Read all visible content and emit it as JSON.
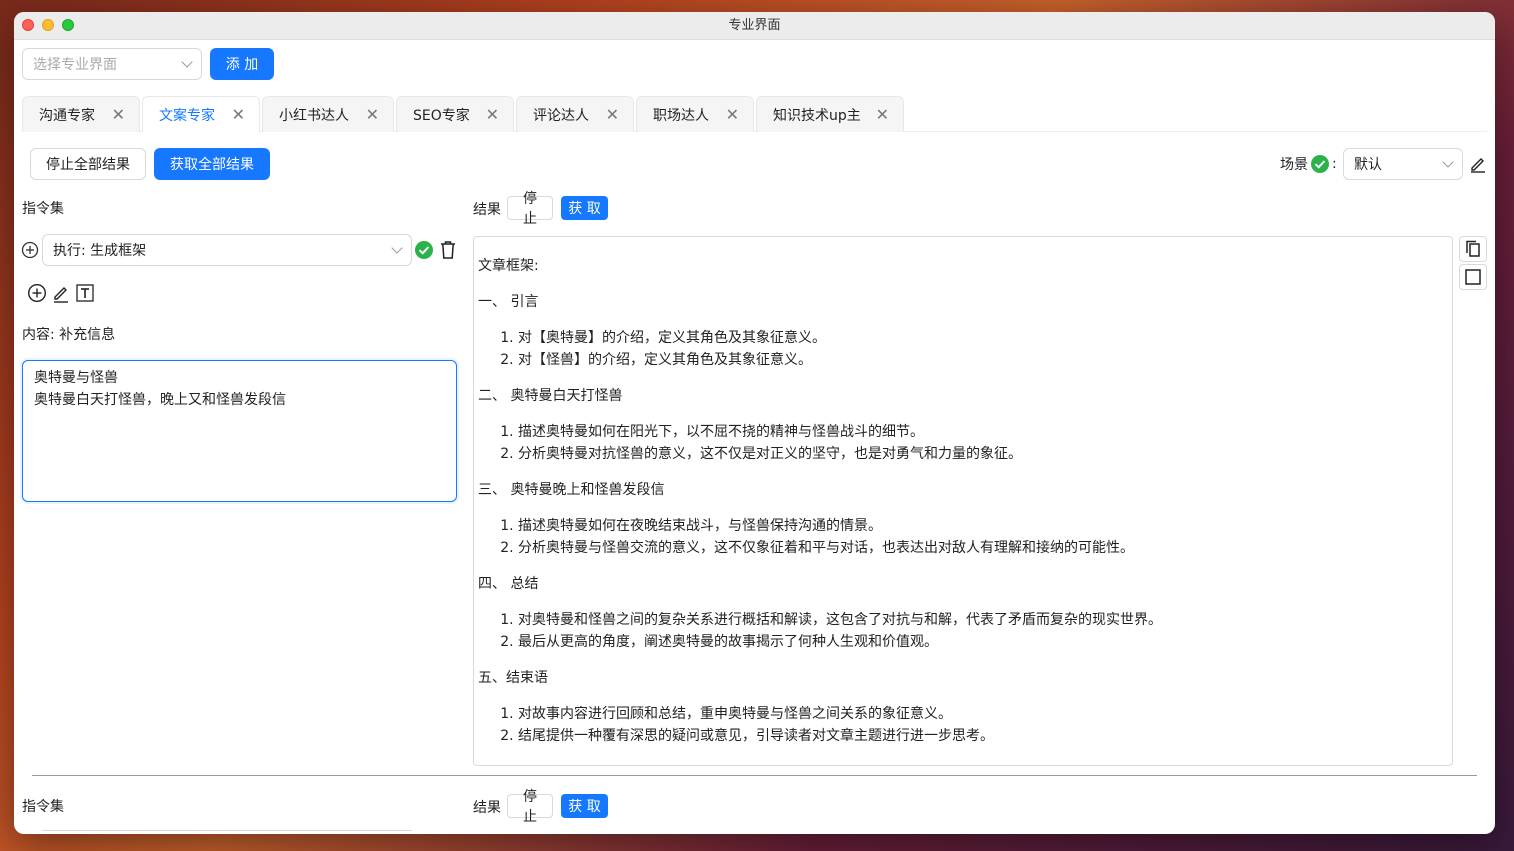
{
  "window": {
    "title": "专业界面"
  },
  "top": {
    "select_placeholder": "选择专业界面",
    "add_label": "添 加"
  },
  "tabs": [
    {
      "label": "沟通专家"
    },
    {
      "label": "文案专家"
    },
    {
      "label": "小红书达人"
    },
    {
      "label": "SEO专家"
    },
    {
      "label": "评论达人"
    },
    {
      "label": "职场达人"
    },
    {
      "label": "知识技术up主"
    }
  ],
  "tab_close_glyph": "✕",
  "toolbar": {
    "stop_all_label": "停止全部结果",
    "get_all_label": "获取全部结果",
    "scene_label": "场景",
    "scene_colon": ":",
    "scene_value": "默认"
  },
  "left": {
    "section_label": "指令集",
    "command_select_value": "执行: 生成框架",
    "content_label": "内容: 补充信息",
    "content_text": "奥特曼与怪兽\n奥特曼白天打怪兽，晚上又和怪兽发段信"
  },
  "right": {
    "result_label": "结果",
    "stop_label": "停 止",
    "get_label": "获 取"
  },
  "result": {
    "intro": "文章框架:",
    "sections": [
      {
        "heading": "一、 引言",
        "items": [
          "对【奥特曼】的介绍，定义其角色及其象征意义。",
          "对【怪兽】的介绍，定义其角色及其象征意义。"
        ]
      },
      {
        "heading": "二、 奥特曼白天打怪兽",
        "items": [
          "描述奥特曼如何在阳光下，以不屈不挠的精神与怪兽战斗的细节。",
          "分析奥特曼对抗怪兽的意义，这不仅是对正义的坚守，也是对勇气和力量的象征。"
        ]
      },
      {
        "heading": "三、 奥特曼晚上和怪兽发段信",
        "items": [
          "描述奥特曼如何在夜晚结束战斗，与怪兽保持沟通的情景。",
          "分析奥特曼与怪兽交流的意义，这不仅象征着和平与对话，也表达出对敌人有理解和接纳的可能性。"
        ]
      },
      {
        "heading": "四、 总结",
        "items": [
          "对奥特曼和怪兽之间的复杂关系进行概括和解读，这包含了对抗与和解，代表了矛盾而复杂的现实世界。",
          "最后从更高的角度，阐述奥特曼的故事揭示了何种人生观和价值观。"
        ]
      },
      {
        "heading": "五、结束语",
        "items": [
          "对故事内容进行回顾和总结，重申奥特曼与怪兽之间关系的象征意义。",
          "结尾提供一种覆有深思的疑问或意见，引导读者对文章主题进行进一步思考。"
        ]
      }
    ]
  },
  "second_block": {
    "section_label": "指令集",
    "result_label": "结果",
    "stop_label": "停 止",
    "get_label": "获 取"
  },
  "colors": {
    "accent": "#1677ff",
    "success": "#2bb34b",
    "border": "#d9d9d9"
  }
}
